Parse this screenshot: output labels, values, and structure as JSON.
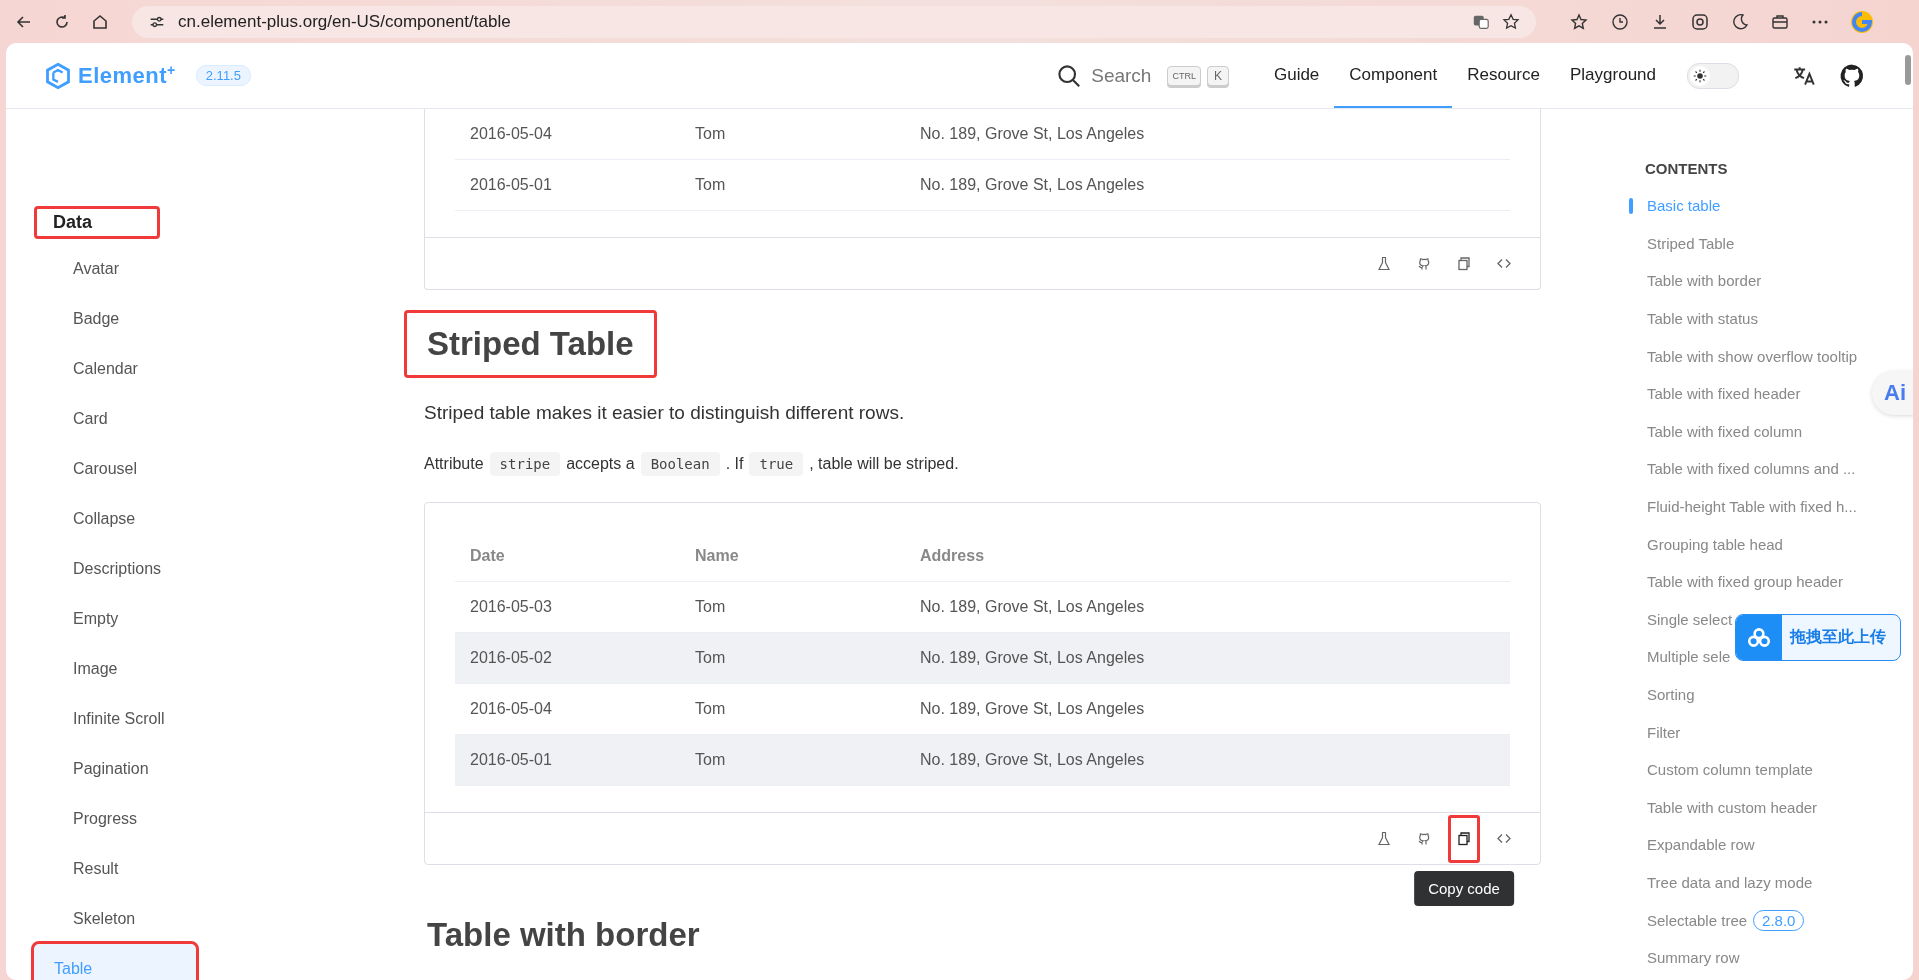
{
  "browser": {
    "url": "cn.element-plus.org/en-US/component/table"
  },
  "header": {
    "logo": "Element",
    "logo_mark": "+",
    "version": "2.11.5",
    "search": {
      "placeholder": "Search",
      "keys": [
        "CTRL",
        "K"
      ]
    },
    "nav": [
      {
        "label": "Guide",
        "selected": false
      },
      {
        "label": "Component",
        "selected": true
      },
      {
        "label": "Resource",
        "selected": false
      },
      {
        "label": "Playground",
        "selected": false
      }
    ],
    "dark_mode": false
  },
  "sidebar": {
    "group": {
      "label": "Data",
      "highlighted": true
    },
    "items": [
      {
        "label": "Avatar",
        "selected": false,
        "highlighted": false
      },
      {
        "label": "Badge",
        "selected": false,
        "highlighted": false
      },
      {
        "label": "Calendar",
        "selected": false,
        "highlighted": false
      },
      {
        "label": "Card",
        "selected": false,
        "highlighted": false
      },
      {
        "label": "Carousel",
        "selected": false,
        "highlighted": false
      },
      {
        "label": "Collapse",
        "selected": false,
        "highlighted": false
      },
      {
        "label": "Descriptions",
        "selected": false,
        "highlighted": false
      },
      {
        "label": "Empty",
        "selected": false,
        "highlighted": false
      },
      {
        "label": "Image",
        "selected": false,
        "highlighted": false
      },
      {
        "label": "Infinite Scroll",
        "selected": false,
        "highlighted": false
      },
      {
        "label": "Pagination",
        "selected": false,
        "highlighted": false
      },
      {
        "label": "Progress",
        "selected": false,
        "highlighted": false
      },
      {
        "label": "Result",
        "selected": false,
        "highlighted": false
      },
      {
        "label": "Skeleton",
        "selected": false,
        "highlighted": false
      },
      {
        "label": "Table",
        "selected": true,
        "highlighted": true
      }
    ]
  },
  "top_demo": {
    "rows": [
      [
        "2016-05-04",
        "Tom",
        "No. 189, Grove St, Los Angeles"
      ],
      [
        "2016-05-01",
        "Tom",
        "No. 189, Grove St, Los Angeles"
      ]
    ],
    "actions": [
      {
        "kind": "flask",
        "highlighted": false
      },
      {
        "kind": "github",
        "highlighted": false
      },
      {
        "kind": "copy",
        "highlighted": false
      },
      {
        "kind": "code",
        "highlighted": false
      }
    ]
  },
  "section": {
    "title": "Striped Table",
    "highlighted": true,
    "description": "Striped table makes it easier to distinguish different rows.",
    "note": [
      {
        "kind": "text",
        "text": "Attribute"
      },
      {
        "kind": "code",
        "text": "stripe"
      },
      {
        "kind": "text",
        "text": "accepts a"
      },
      {
        "kind": "code",
        "text": "Boolean"
      },
      {
        "kind": "text",
        "text": ". If"
      },
      {
        "kind": "code",
        "text": "true"
      },
      {
        "kind": "text",
        "text": ", table will be striped."
      }
    ],
    "demo": {
      "stripe": true,
      "columns": [
        "Date",
        "Name",
        "Address"
      ],
      "rows": [
        [
          "2016-05-03",
          "Tom",
          "No. 189, Grove St, Los Angeles"
        ],
        [
          "2016-05-02",
          "Tom",
          "No. 189, Grove St, Los Angeles"
        ],
        [
          "2016-05-04",
          "Tom",
          "No. 189, Grove St, Los Angeles"
        ],
        [
          "2016-05-01",
          "Tom",
          "No. 189, Grove St, Los Angeles"
        ]
      ],
      "actions": [
        {
          "kind": "flask",
          "highlighted": false
        },
        {
          "kind": "github",
          "highlighted": false
        },
        {
          "kind": "copy",
          "highlighted": true,
          "tooltip": "Copy code"
        },
        {
          "kind": "code",
          "highlighted": false
        }
      ]
    }
  },
  "next_section": {
    "title": "Table with border"
  },
  "toc": {
    "title": "CONTENTS",
    "items": [
      {
        "label": "Basic table",
        "selected": true
      },
      {
        "label": "Striped Table",
        "selected": false
      },
      {
        "label": "Table with border",
        "selected": false
      },
      {
        "label": "Table with status",
        "selected": false
      },
      {
        "label": "Table with show overflow tooltip",
        "selected": false
      },
      {
        "label": "Table with fixed header",
        "selected": false
      },
      {
        "label": "Table with fixed column",
        "selected": false
      },
      {
        "label": "Table with fixed columns and ...",
        "selected": false
      },
      {
        "label": "Fluid-height Table with fixed h...",
        "selected": false
      },
      {
        "label": "Grouping table head",
        "selected": false
      },
      {
        "label": "Table with fixed group header",
        "selected": false
      },
      {
        "label": "Single select",
        "selected": false
      },
      {
        "label": "Multiple sele",
        "selected": false
      },
      {
        "label": "Sorting",
        "selected": false
      },
      {
        "label": "Filter",
        "selected": false
      },
      {
        "label": "Custom column template",
        "selected": false
      },
      {
        "label": "Table with custom header",
        "selected": false
      },
      {
        "label": "Expandable row",
        "selected": false
      },
      {
        "label": "Tree data and lazy mode",
        "selected": false
      },
      {
        "label": "Selectable tree",
        "selected": false,
        "badge": "2.8.0"
      },
      {
        "label": "Summary row",
        "selected": false
      }
    ]
  },
  "ai_button": {
    "label": "Ai"
  },
  "upload_widget": {
    "label": "拖拽至此上传"
  }
}
